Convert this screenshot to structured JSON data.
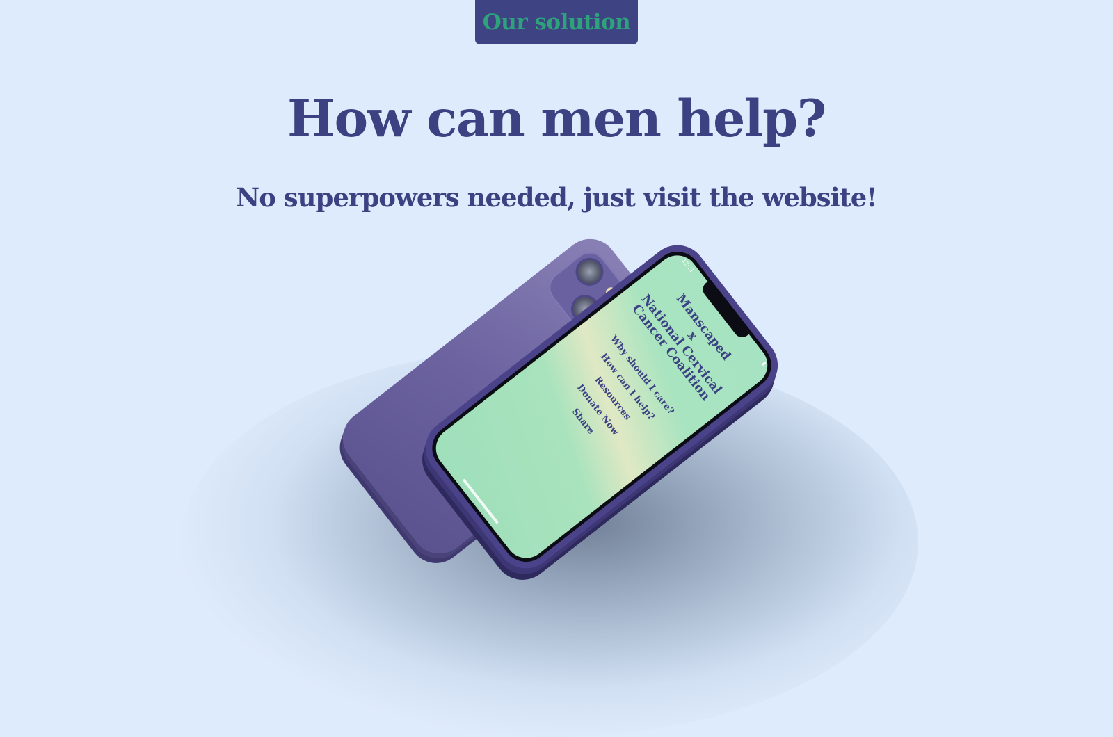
{
  "badge": {
    "label": "Our solution"
  },
  "headline": "How can men help?",
  "subheadline": "No superpowers needed, just visit the website!",
  "phone": {
    "status_time": "12:21",
    "site_title_lines": [
      "Manscaped",
      "x",
      "National Cervical",
      "Cancer Coalition"
    ],
    "menu_items": [
      "Why should I care?",
      "How can I help?",
      "Resources",
      "Donate Now",
      "Share"
    ]
  },
  "colors": {
    "background": "#deebfc",
    "brand_navy": "#3c4181",
    "badge_text": "#2ea37b",
    "phone_body": "#6c63a0",
    "screen_green": "#a6e3c2"
  }
}
